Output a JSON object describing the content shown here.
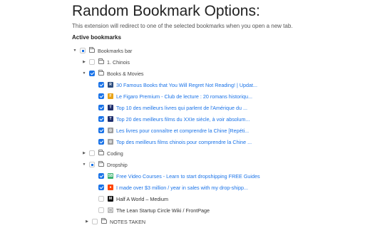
{
  "page": {
    "title": "Random Bookmark Options:",
    "description": "This extension will redirect to one of the selected bookmarks when you open a new tab.",
    "section_label": "Active bookmarks"
  },
  "tree": [
    {
      "type": "folder",
      "label": "Bookmarks bar",
      "state": "partial",
      "caret": "▼"
    },
    {
      "type": "folder",
      "label": "1. Chinois",
      "state": "unchecked",
      "caret": "▶"
    },
    {
      "type": "folder",
      "label": "Books & Movies",
      "state": "checked",
      "caret": "▼"
    },
    {
      "type": "link",
      "label": "30 Famous Books that You Will Regret Not Reading! | Updat...",
      "state": "checked",
      "icon": "R",
      "icon_color": "#2b4c7e"
    },
    {
      "type": "link",
      "label": "Le Figaro Premium - Club de lecture : 20 romans historiqu...",
      "state": "checked",
      "icon": "F",
      "icon_color": "#e8a317"
    },
    {
      "type": "link",
      "label": "Top 10 des meilleurs livres qui parlent de l'Amérique du ...",
      "state": "checked",
      "icon": "T",
      "icon_color": "#1f2f6e"
    },
    {
      "type": "link",
      "label": "Top 20 des meilleurs films du XXIe siècle, à voir absolum...",
      "state": "checked",
      "icon": "T",
      "icon_color": "#1f2f6e"
    },
    {
      "type": "link",
      "label": "Les livres pour connaître et comprendre la Chine [Repéti...",
      "state": "checked",
      "icon": "◎",
      "icon_color": "#9e9e9e"
    },
    {
      "type": "link",
      "label": "Top des meilleurs films chinois pour comprendre la Chine ...",
      "state": "checked",
      "icon": "◎",
      "icon_color": "#9e9e9e"
    },
    {
      "type": "folder",
      "label": "Coding",
      "state": "unchecked",
      "caret": "▶"
    },
    {
      "type": "folder",
      "label": "Dropship",
      "state": "partial",
      "caret": "▼"
    },
    {
      "type": "link",
      "label": "Free Video Courses - Learn to start dropshipping FREE Guides",
      "state": "checked",
      "icon": "SB",
      "icon_color": "#3cb371"
    },
    {
      "type": "link",
      "label": "I made over $3 million / year in sales with my drop-shipp...",
      "state": "checked",
      "icon": "●",
      "icon_color": "#ff4500"
    },
    {
      "type": "link",
      "label": "Half A World – Medium",
      "state": "unchecked",
      "icon": "M",
      "icon_color": "#111111",
      "dark": true
    },
    {
      "type": "link",
      "label": "The Lean Startup Circle Wiki / FrontPage",
      "state": "unchecked",
      "icon": "◯",
      "icon_color": "#bbbbbb",
      "dark": true
    },
    {
      "type": "folder",
      "label": "NOTES TAKEN",
      "state": "unchecked",
      "caret": "▶"
    }
  ]
}
